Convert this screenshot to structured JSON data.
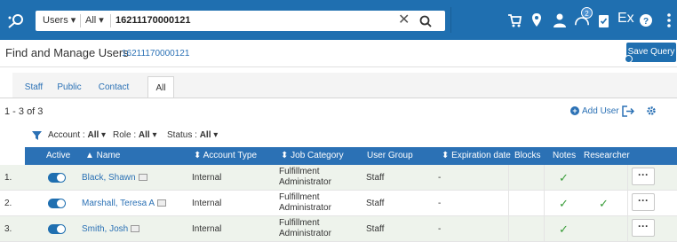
{
  "topbar": {
    "scope_users": "Users ▾",
    "scope_all": "All ▾",
    "search_value": "16211170000121",
    "clear_symbol": "✕",
    "notifications_count": "2",
    "ex_label": "Ex",
    "icons": [
      "cart-icon",
      "location-icon",
      "user-icon",
      "notifications-icon",
      "tasks-icon",
      "ex-icon",
      "help-icon",
      "more-vertical-icon"
    ],
    "colors": {
      "bar": "#1f6fb0",
      "accent": "#2b71b5"
    }
  },
  "header": {
    "title": "Find and Manage Users",
    "title_id": "16211170000121",
    "save_query": "Save Query"
  },
  "tabs": [
    {
      "label": "Staff"
    },
    {
      "label": "Public"
    },
    {
      "label": "Contact"
    },
    {
      "label": "All",
      "active": true
    }
  ],
  "results": {
    "count": "1 - 3 of 3",
    "add_user": "Add User"
  },
  "facets": {
    "account_label": "Account :",
    "account_value": "All",
    "role_label": "Role :",
    "role_value": "All",
    "status_label": "Status :",
    "status_value": "All"
  },
  "table": {
    "columns": {
      "active": "Active",
      "name": "▲ Name",
      "account_type": "⬍ Account Type",
      "job_category": "⬍ Job Category",
      "user_group": "User Group",
      "expiration_date": "⬍ Expiration date",
      "blocks": "Blocks",
      "notes": "Notes",
      "researcher": "Researcher"
    },
    "rows": [
      {
        "num": "1.",
        "active": true,
        "name": "Black, Shawn",
        "account_type": "Internal",
        "job_line1": "Fulfillment",
        "job_line2": "Administrator",
        "user_group": "Staff",
        "expiration": "-",
        "notes": "✓",
        "researcher": "",
        "more": "···"
      },
      {
        "num": "2.",
        "active": true,
        "name": "Marshall, Teresa A",
        "account_type": "Internal",
        "job_line1": "Fulfillment",
        "job_line2": "Administrator",
        "user_group": "Staff",
        "expiration": "-",
        "notes": "✓",
        "researcher": "✓",
        "more": "···"
      },
      {
        "num": "3.",
        "active": true,
        "name": "Smith, Josh",
        "account_type": "Internal",
        "job_line1": "Fulfillment",
        "job_line2": "Administrator",
        "user_group": "Staff",
        "expiration": "-",
        "notes": "✓",
        "researcher": "",
        "more": "···"
      }
    ]
  }
}
